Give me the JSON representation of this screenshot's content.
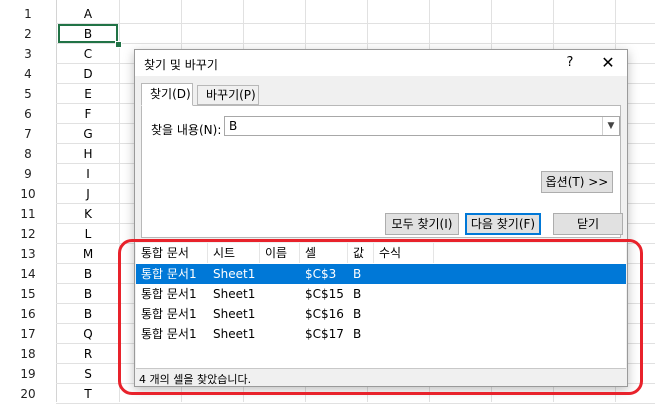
{
  "sheet": {
    "rows": [
      {
        "num": "1",
        "a": "A"
      },
      {
        "num": "2",
        "a": "B"
      },
      {
        "num": "3",
        "a": "C"
      },
      {
        "num": "4",
        "a": "D"
      },
      {
        "num": "5",
        "a": "E"
      },
      {
        "num": "6",
        "a": "F"
      },
      {
        "num": "7",
        "a": "G"
      },
      {
        "num": "8",
        "a": "H"
      },
      {
        "num": "9",
        "a": "I"
      },
      {
        "num": "10",
        "a": "J"
      },
      {
        "num": "11",
        "a": "K"
      },
      {
        "num": "12",
        "a": "L"
      },
      {
        "num": "13",
        "a": "M"
      },
      {
        "num": "14",
        "a": "B"
      },
      {
        "num": "15",
        "a": "B"
      },
      {
        "num": "16",
        "a": "B"
      },
      {
        "num": "17",
        "a": "Q"
      },
      {
        "num": "18",
        "a": "R"
      },
      {
        "num": "19",
        "a": "S"
      },
      {
        "num": "20",
        "a": "T"
      }
    ]
  },
  "dialog": {
    "title": "찾기 및 바꾸기",
    "help": "?",
    "close": "✕",
    "tabs": [
      {
        "label": "찾기(D)"
      },
      {
        "label": "바꾸기(P)"
      }
    ],
    "find_label": "찾을 내용(N):",
    "find_value": "B",
    "dropdown_icon": "▼",
    "options_label": "옵션(T) >>",
    "find_all_label": "모두 찾기(I)",
    "find_next_label": "다음 찾기(F)",
    "close_label": "닫기"
  },
  "results": {
    "columns": [
      "통합 문서",
      "시트",
      "이름",
      "셀",
      "값",
      "수식"
    ],
    "rows": [
      [
        "통합 문서1",
        "Sheet1",
        "",
        "$C$3",
        "B",
        ""
      ],
      [
        "통합 문서1",
        "Sheet1",
        "",
        "$C$15",
        "B",
        ""
      ],
      [
        "통합 문서1",
        "Sheet1",
        "",
        "$C$16",
        "B",
        ""
      ],
      [
        "통합 문서1",
        "Sheet1",
        "",
        "$C$17",
        "B",
        ""
      ]
    ],
    "status": "4 개의 셀을 찾았습니다."
  },
  "colors": {
    "selection": "#0078d7",
    "highlight": "#e8222b",
    "cell_cursor": "#217346"
  }
}
